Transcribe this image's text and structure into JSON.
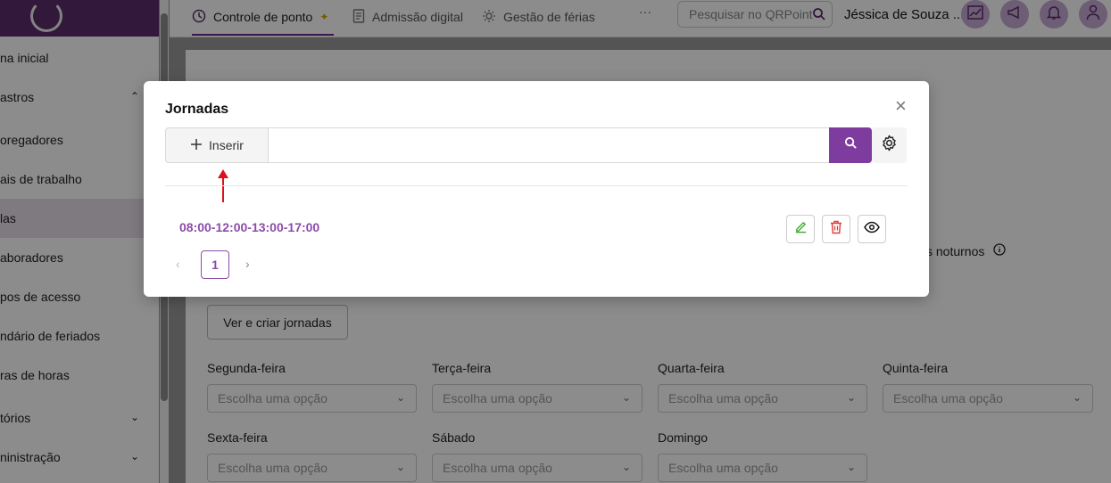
{
  "sidebar": {
    "items": [
      {
        "label": "na inicial",
        "chevron": ""
      },
      {
        "label": "astros",
        "chevron": "⌃"
      },
      {
        "label": "oregadores",
        "chevron": ""
      },
      {
        "label": "ais de trabalho",
        "chevron": ""
      },
      {
        "label": "las",
        "chevron": ""
      },
      {
        "label": "aboradores",
        "chevron": ""
      },
      {
        "label": "pos de acesso",
        "chevron": ""
      },
      {
        "label": "ndário de feriados",
        "chevron": ""
      },
      {
        "label": "ras de horas",
        "chevron": ""
      },
      {
        "label": "tórios",
        "chevron": "⌄"
      },
      {
        "label": "ninistração",
        "chevron": "⌄"
      }
    ]
  },
  "topbar": {
    "tabs": [
      {
        "label": "Controle de ponto",
        "icon": "clock-icon"
      },
      {
        "label": "Admissão digital",
        "icon": "document-icon"
      },
      {
        "label": "Gestão de férias",
        "icon": "sun-icon"
      }
    ],
    "more_label": "···",
    "search_placeholder": "Pesquisar no QRPoint",
    "user_name": "Jéssica de Souza ..."
  },
  "background": {
    "ver_button": "Ver e criar jornadas",
    "noturnos_text": "s noturnos",
    "days": [
      "Segunda-feira",
      "Terça-feira",
      "Quarta-feira",
      "Quinta-feira",
      "Sexta-feira",
      "Sábado",
      "Domingo"
    ],
    "select_placeholder": "Escolha uma opção"
  },
  "modal": {
    "title": "Jornadas",
    "insert_label": "Inserir",
    "search_value": "",
    "close_symbol": "×",
    "items": [
      {
        "label": "08:00-12:00-13:00-17:00"
      }
    ],
    "pagination": {
      "prev": "‹",
      "current": "1",
      "next": "›"
    }
  },
  "colors": {
    "brand_purple": "#7e3d9e",
    "link_purple": "#8b4ca8",
    "annotation_red": "#e0101a",
    "edit_green": "#3daa2b",
    "delete_red": "#e23a3a"
  }
}
